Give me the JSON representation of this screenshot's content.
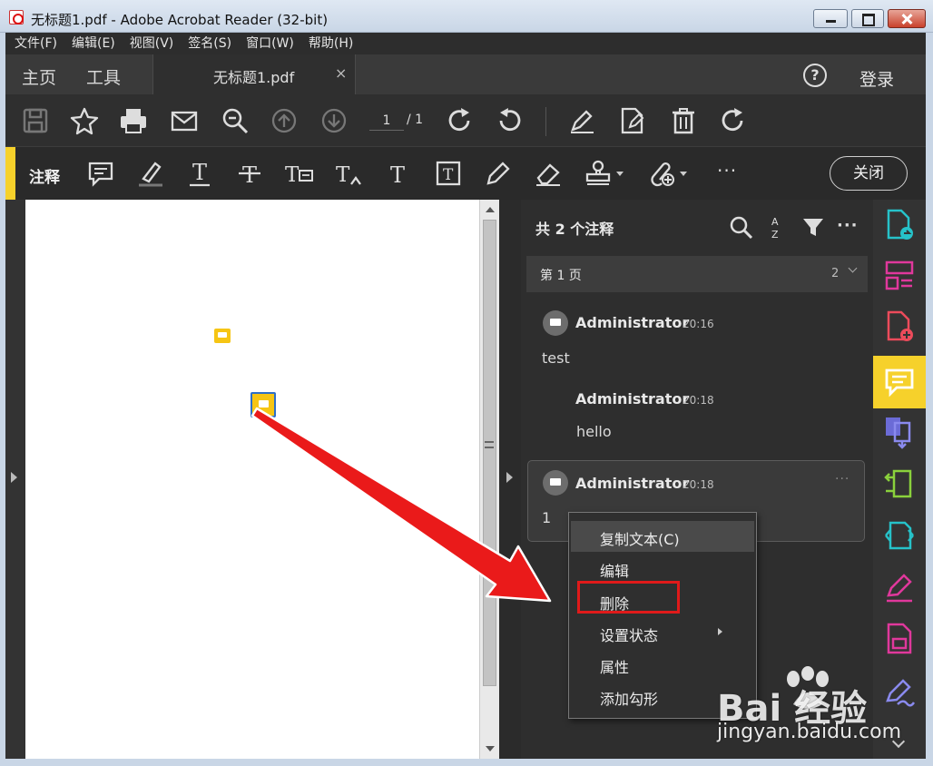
{
  "window": {
    "title": "无标题1.pdf - Adobe Acrobat Reader (32-bit)"
  },
  "menu": [
    "文件(F)",
    "编辑(E)",
    "视图(V)",
    "签名(S)",
    "窗口(W)",
    "帮助(H)"
  ],
  "tabs": {
    "home": "主页",
    "tools": "工具",
    "document": "无标题1.pdf",
    "close_glyph": "×",
    "help": "?",
    "login": "登录"
  },
  "toolbar": {
    "page_current": "1",
    "page_total": "/ 1"
  },
  "comment_toolbar": {
    "label": "注释",
    "more": "···",
    "close_label": "关闭"
  },
  "comments_panel": {
    "count": "共 2 个注释",
    "sort_icon": "sort-az-icon",
    "more": "···",
    "page_group": {
      "label": "第 1 页",
      "count": "2"
    },
    "comments": [
      {
        "author": "Administrator",
        "time": "20:16",
        "text": "test"
      },
      {
        "author": "Administrator",
        "time": "20:18",
        "text": "hello"
      },
      {
        "author": "Administrator",
        "time": "20:18",
        "text": "1"
      }
    ]
  },
  "context_menu": {
    "items": [
      "复制文本(C)",
      "编辑",
      "删除",
      "设置状态",
      "属性",
      "添加勾形"
    ]
  },
  "watermark": {
    "brand": "Bai 经验",
    "url": "jingyan.baidu.com"
  },
  "colors": {
    "accent": "#f6d12b",
    "highlight_box": "#e01a1a",
    "note": "#f6c514"
  }
}
